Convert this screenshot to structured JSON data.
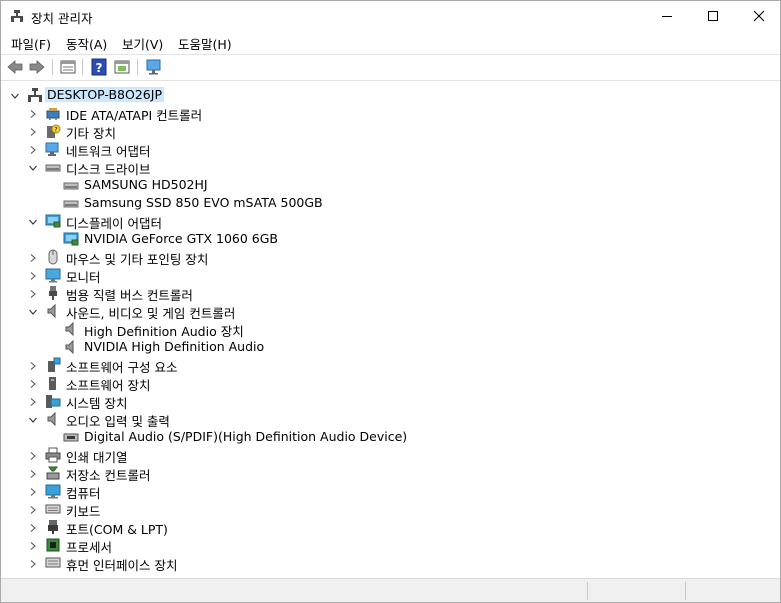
{
  "window": {
    "title": "장치 관리자"
  },
  "menu": [
    "파일(F)",
    "동작(A)",
    "보기(V)",
    "도움말(H)"
  ],
  "toolbar": [
    "back-icon",
    "forward-icon",
    "properties-icon",
    "help-icon",
    "view-icon",
    "monitor-scan-icon"
  ],
  "tree": {
    "root": "DESKTOP-B8O26JP",
    "rows": [
      {
        "label": "IDE ATA/ATAPI 컨트롤러",
        "icon": "ide-controller-icon",
        "level": 1,
        "expanded": false
      },
      {
        "label": "기타 장치",
        "icon": "other-devices-icon",
        "level": 1,
        "expanded": false
      },
      {
        "label": "네트워크 어댑터",
        "icon": "network-adapter-icon",
        "level": 1,
        "expanded": false
      },
      {
        "label": "디스크 드라이브",
        "icon": "disk-drive-icon",
        "level": 1,
        "expanded": true
      },
      {
        "label": "SAMSUNG HD502HJ",
        "icon": "disk-drive-icon",
        "level": 2
      },
      {
        "label": "Samsung SSD 850 EVO mSATA 500GB",
        "icon": "disk-drive-icon",
        "level": 2
      },
      {
        "label": "디스플레이 어댑터",
        "icon": "display-adapter-icon",
        "level": 1,
        "expanded": true
      },
      {
        "label": "NVIDIA GeForce GTX 1060 6GB",
        "icon": "display-adapter-icon",
        "level": 2
      },
      {
        "label": "마우스 및 기타 포인팅 장치",
        "icon": "mouse-icon",
        "level": 1,
        "expanded": false
      },
      {
        "label": "모니터",
        "icon": "monitor-icon",
        "level": 1,
        "expanded": false
      },
      {
        "label": "범용 직렬 버스 컨트롤러",
        "icon": "usb-icon",
        "level": 1,
        "expanded": false
      },
      {
        "label": "사운드, 비디오 및 게임 컨트롤러",
        "icon": "speaker-icon",
        "level": 1,
        "expanded": true
      },
      {
        "label": "High Definition Audio 장치",
        "icon": "speaker-icon",
        "level": 2
      },
      {
        "label": "NVIDIA High Definition Audio",
        "icon": "speaker-icon",
        "level": 2
      },
      {
        "label": "소프트웨어 구성 요소",
        "icon": "software-component-icon",
        "level": 1,
        "expanded": false
      },
      {
        "label": "소프트웨어 장치",
        "icon": "software-device-icon",
        "level": 1,
        "expanded": false
      },
      {
        "label": "시스템 장치",
        "icon": "system-device-icon",
        "level": 1,
        "expanded": false
      },
      {
        "label": "오디오 입력 및 출력",
        "icon": "speaker-icon",
        "level": 1,
        "expanded": true
      },
      {
        "label": "Digital Audio (S/PDIF)(High Definition Audio Device)",
        "icon": "audio-port-icon",
        "level": 2
      },
      {
        "label": "인쇄 대기열",
        "icon": "printer-icon",
        "level": 1,
        "expanded": false
      },
      {
        "label": "저장소 컨트롤러",
        "icon": "storage-controller-icon",
        "level": 1,
        "expanded": false
      },
      {
        "label": "컴퓨터",
        "icon": "computer-icon",
        "level": 1,
        "expanded": false
      },
      {
        "label": "키보드",
        "icon": "keyboard-icon",
        "level": 1,
        "expanded": false
      },
      {
        "label": "포트(COM & LPT)",
        "icon": "port-icon",
        "level": 1,
        "expanded": false
      },
      {
        "label": "프로세서",
        "icon": "processor-icon",
        "level": 1,
        "expanded": false
      },
      {
        "label": "휴먼 인터페이스 장치",
        "icon": "hid-icon",
        "level": 1,
        "expanded": false
      }
    ]
  }
}
